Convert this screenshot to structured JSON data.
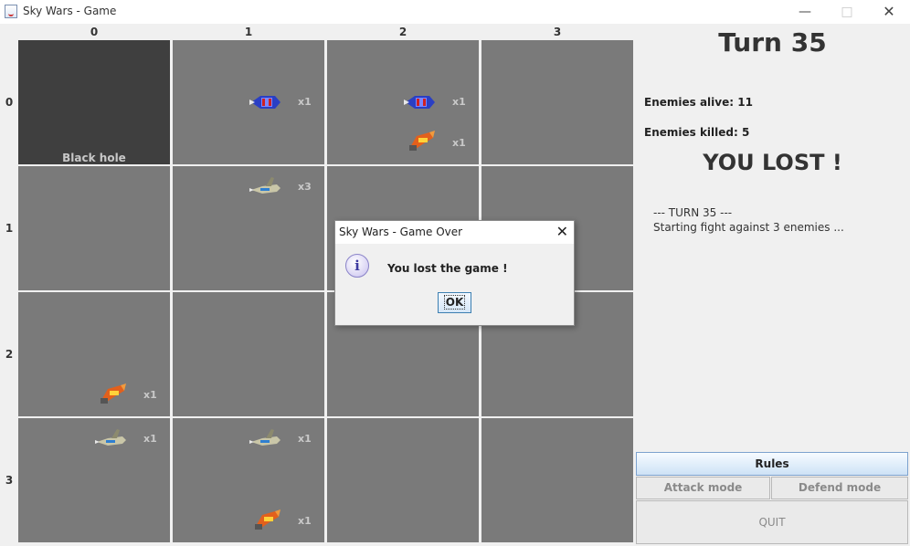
{
  "window": {
    "title": "Sky Wars - Game"
  },
  "board": {
    "columns": [
      "0",
      "1",
      "2",
      "3"
    ],
    "rows": [
      "0",
      "1",
      "2",
      "3"
    ],
    "black_hole_label": "Black hole",
    "counts": {
      "r0c1": "x1",
      "r0c2_a": "x1",
      "r0c2_b": "x1",
      "r1c1": "x3",
      "r2c0": "x1",
      "r3c0": "x1",
      "r3c1_a": "x1",
      "r3c1_b": "x1"
    }
  },
  "status": {
    "turn": "Turn 35",
    "enemies_alive": "Enemies alive: 11",
    "enemies_killed": "Enemies killed: 5",
    "result": "YOU LOST !"
  },
  "log": [
    "--- TURN 35 ---",
    "Starting fight against 3 enemies ..."
  ],
  "buttons": {
    "rules": "Rules",
    "attack": "Attack mode",
    "defend": "Defend mode",
    "quit": "QUIT"
  },
  "dialog": {
    "title": "Sky Wars - Game Over",
    "message": "You lost the game !",
    "ok": "OK"
  },
  "colors": {
    "cell": "#7a7a7a",
    "black_hole": "#3f3f3f",
    "ship_blue": "#2a3fc4",
    "ship_orange": "#e2601c",
    "ship_grey": "#c9c6a8"
  }
}
